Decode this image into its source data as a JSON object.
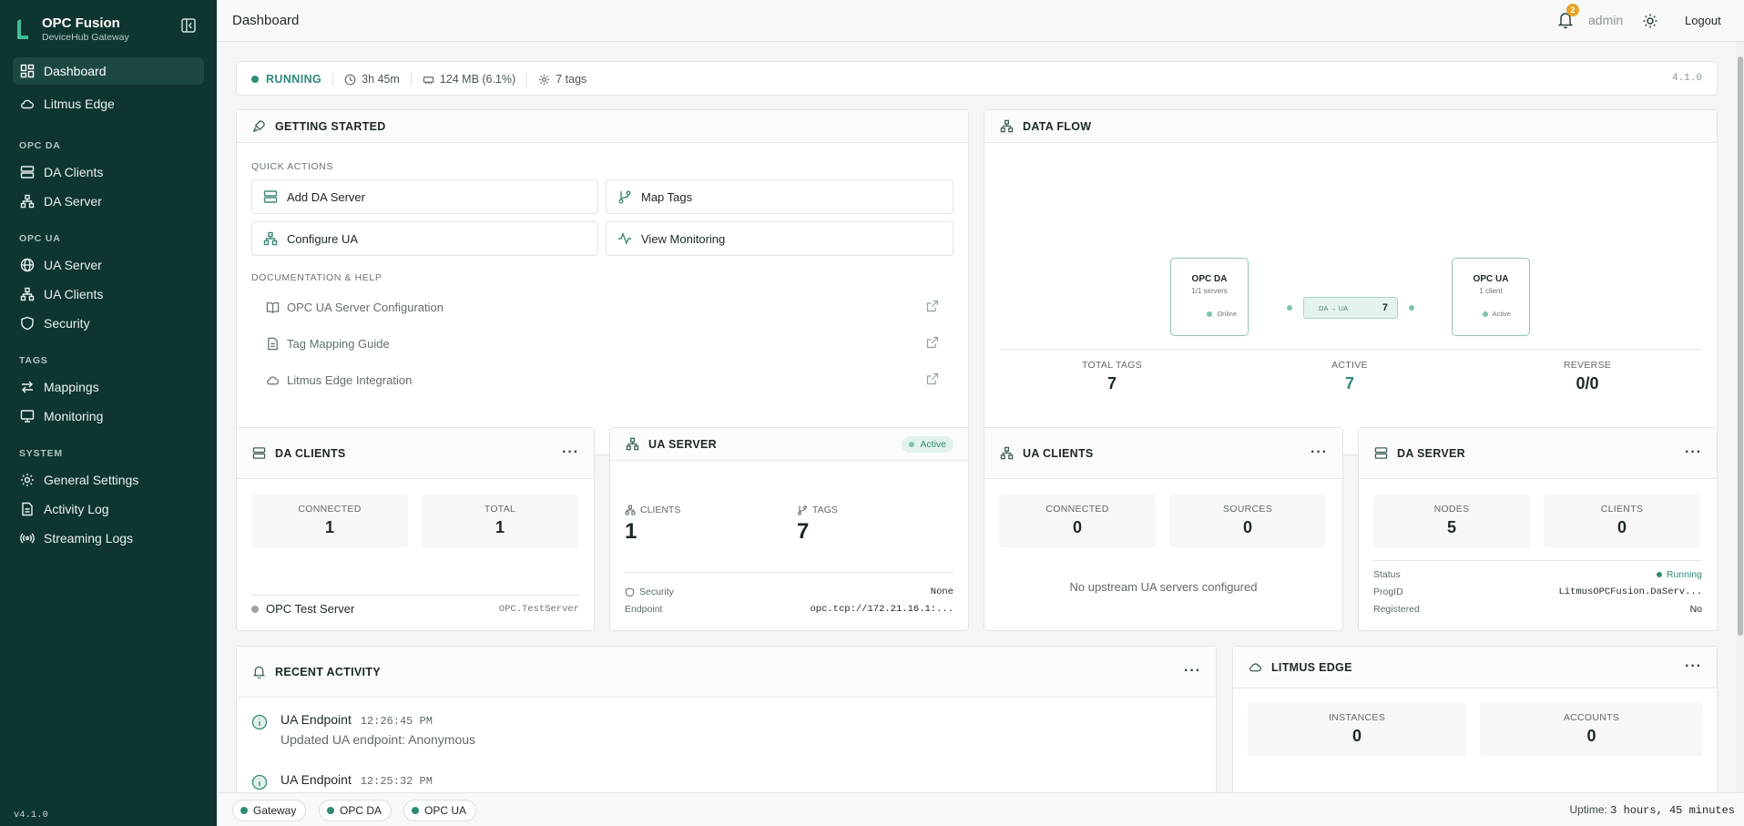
{
  "sidebar": {
    "brand_title": "OPC Fusion",
    "brand_sub": "DeviceHub Gateway",
    "items_top": [
      {
        "label": "Dashboard",
        "icon": "dashboard-icon"
      },
      {
        "label": "Litmus Edge",
        "icon": "cloud-icon"
      }
    ],
    "sections": [
      {
        "title": "OPC DA",
        "items": [
          {
            "label": "DA Clients",
            "icon": "server-icon"
          },
          {
            "label": "DA Server",
            "icon": "network-icon"
          }
        ]
      },
      {
        "title": "OPC UA",
        "items": [
          {
            "label": "UA Server",
            "icon": "globe-icon"
          },
          {
            "label": "UA Clients",
            "icon": "network-icon"
          },
          {
            "label": "Security",
            "icon": "shield-icon"
          }
        ]
      },
      {
        "title": "TAGS",
        "items": [
          {
            "label": "Mappings",
            "icon": "arrows-icon"
          },
          {
            "label": "Monitoring",
            "icon": "monitor-icon"
          }
        ]
      },
      {
        "title": "SYSTEM",
        "items": [
          {
            "label": "General Settings",
            "icon": "gear-icon"
          },
          {
            "label": "Activity Log",
            "icon": "document-icon"
          },
          {
            "label": "Streaming Logs",
            "icon": "broadcast-icon"
          }
        ]
      }
    ],
    "version": "v4.1.0"
  },
  "topbar": {
    "title": "Dashboard",
    "notification_count": "2",
    "user": "admin",
    "logout": "Logout"
  },
  "status": {
    "state": "RUNNING",
    "uptime": "3h 45m",
    "memory": "124 MB (6.1%)",
    "tags": "7 tags",
    "version": "4.1.0"
  },
  "getting_started": {
    "title": "GETTING STARTED",
    "quick_actions_label": "QUICK ACTIONS",
    "actions": [
      "Add DA Server",
      "Map Tags",
      "Configure UA",
      "View Monitoring"
    ],
    "docs_label": "DOCUMENTATION & HELP",
    "docs": [
      "OPC UA Server Configuration",
      "Tag Mapping Guide",
      "Litmus Edge Integration"
    ]
  },
  "data_flow": {
    "title": "DATA FLOW",
    "left_node": {
      "title": "OPC DA",
      "sub": "1/1 servers",
      "status": "Online"
    },
    "link": {
      "label": "DA → UA",
      "count": "7"
    },
    "right_node": {
      "title": "OPC UA",
      "sub": "1 client",
      "status": "Active"
    },
    "stats": [
      {
        "label": "TOTAL TAGS",
        "value": "7"
      },
      {
        "label": "ACTIVE",
        "value": "7"
      },
      {
        "label": "REVERSE",
        "value": "0/0"
      }
    ]
  },
  "da_clients": {
    "title": "DA CLIENTS",
    "connected_label": "CONNECTED",
    "connected": "1",
    "total_label": "TOTAL",
    "total": "1",
    "server_name": "OPC Test Server",
    "server_id": "OPC.TestServer"
  },
  "ua_server": {
    "title": "UA SERVER",
    "badge": "Active",
    "clients_label": "CLIENTS",
    "clients": "1",
    "tags_label": "TAGS",
    "tags": "7",
    "security_label": "Security",
    "security": "None",
    "endpoint_label": "Endpoint",
    "endpoint": "opc.tcp://172.21.16.1:..."
  },
  "ua_clients": {
    "title": "UA CLIENTS",
    "connected_label": "CONNECTED",
    "connected": "0",
    "sources_label": "SOURCES",
    "sources": "0",
    "empty": "No upstream UA servers configured"
  },
  "da_server": {
    "title": "DA SERVER",
    "nodes_label": "NODES",
    "nodes": "5",
    "clients_label": "CLIENTS",
    "clients": "0",
    "status_label": "Status",
    "status": "Running",
    "progid_label": "ProgID",
    "progid": "LitmusOPCFusion.DaServ...",
    "registered_label": "Registered",
    "registered": "No"
  },
  "recent_activity": {
    "title": "RECENT ACTIVITY",
    "items": [
      {
        "title": "UA Endpoint",
        "time": "12:26:45 PM",
        "desc": "Updated UA endpoint: Anonymous"
      },
      {
        "title": "UA Endpoint",
        "time": "12:25:32 PM",
        "desc": ""
      }
    ]
  },
  "litmus_edge": {
    "title": "LITMUS EDGE",
    "instances_label": "INSTANCES",
    "instances": "0",
    "accounts_label": "ACCOUNTS",
    "accounts": "0"
  },
  "footer": {
    "pills": [
      "Gateway",
      "OPC DA",
      "OPC UA"
    ],
    "uptime_label": "Uptime:",
    "uptime": "3 hours, 45 minutes"
  },
  "colors": {
    "sidebar": "#0f3530",
    "accent": "#2e8b76",
    "badge": "#e6a52a"
  }
}
